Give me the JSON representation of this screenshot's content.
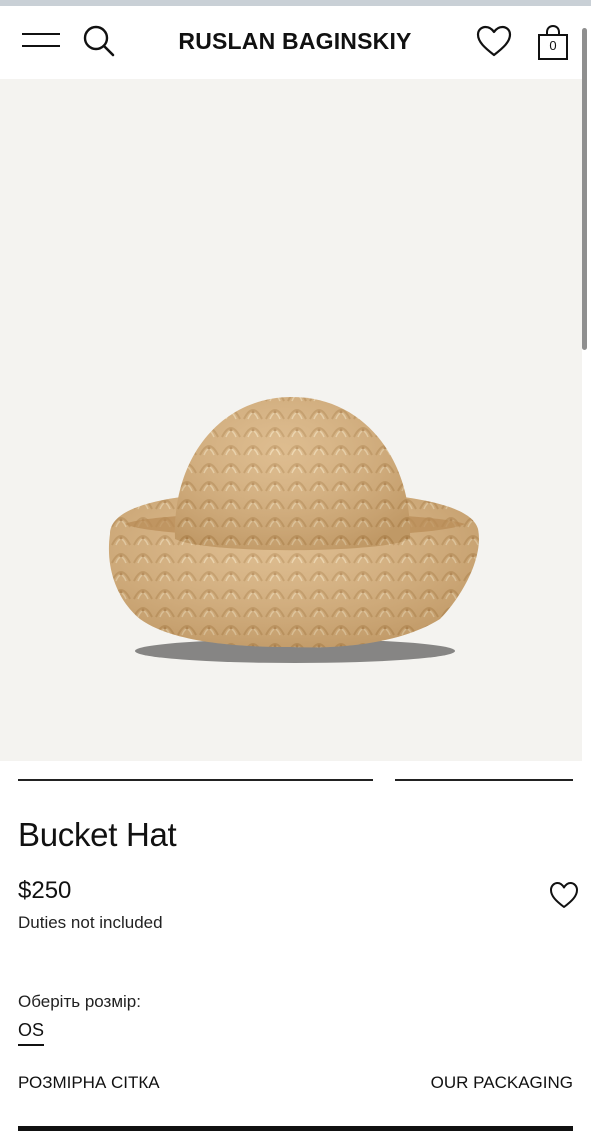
{
  "header": {
    "brand": "RUSLAN BAGINSKIY",
    "cart_count": "0",
    "icons": [
      "menu-icon",
      "search-icon",
      "heart-icon",
      "shopping-bag-icon"
    ]
  },
  "product": {
    "image_alt": "Bucket Hat",
    "gallery": {
      "images": 2,
      "active": 1
    },
    "title": "Bucket Hat",
    "price": "$250",
    "duties_note": "Duties not included",
    "size_prompt": "Оберіть розмір:",
    "sizes": [
      "OS"
    ],
    "selected_size": "OS",
    "size_chart_link": "РОЗМІРНА СІТКА",
    "packaging_link": "OUR PACKAGING"
  },
  "colors": {
    "image_background": "#f4f3f0",
    "straw": "#d9b382",
    "text": "#111111"
  }
}
